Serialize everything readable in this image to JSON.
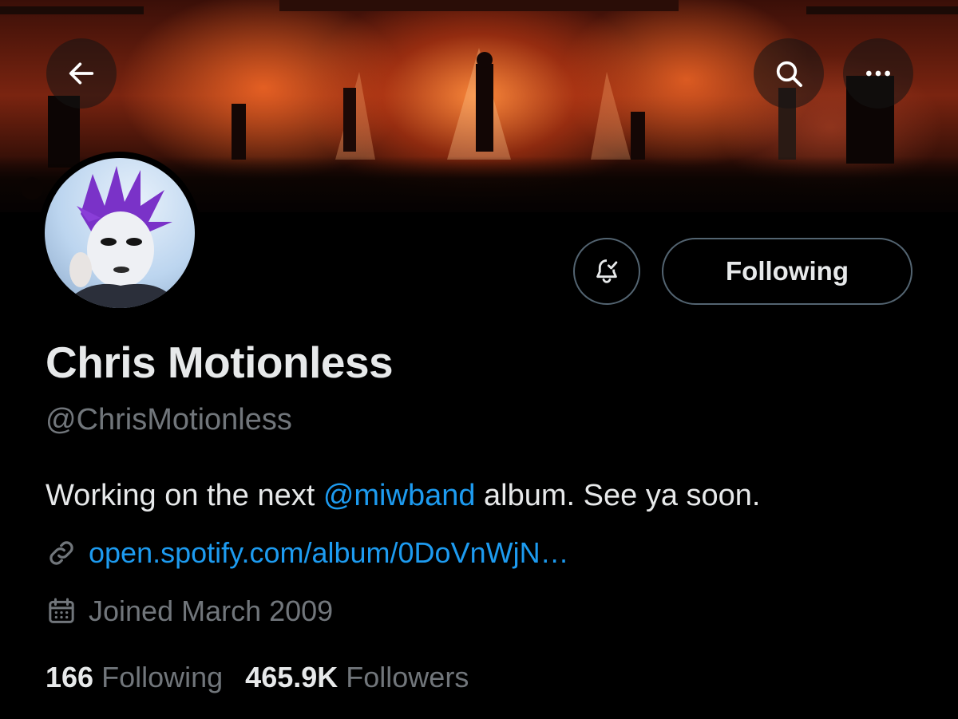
{
  "header": {
    "back_icon": "arrow-left-icon",
    "search_icon": "search-icon",
    "more_icon": "more-horizontal-icon"
  },
  "profile": {
    "name": "Chris Motionless",
    "handle": "@ChrisMotionless",
    "bio_prefix": "Working on the next ",
    "bio_mention": "@miwband",
    "bio_suffix": " album. See ya soon.",
    "link": "open.spotify.com/album/0DoVnWjN…",
    "joined": "Joined March 2009",
    "following_count": "166",
    "following_label": "Following",
    "followers_count": "465.9K",
    "followers_label": "Followers"
  },
  "actions": {
    "notifications_icon": "bell-check-icon",
    "follow_button_label": "Following"
  },
  "colors": {
    "accent": "#1d9bf0",
    "muted": "#71767b",
    "text": "#e7e9ea",
    "background": "#000000"
  }
}
